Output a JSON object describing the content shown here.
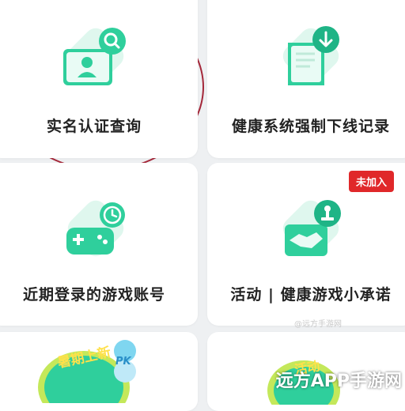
{
  "cards": {
    "realname": {
      "label": "实名认证查询"
    },
    "offline": {
      "label": "健康系统强制下线记录"
    },
    "login_accounts": {
      "label": "近期登录的游戏账号"
    },
    "activity": {
      "label": "活动 | 健康游戏小承诺",
      "badge": "未加入"
    }
  },
  "bottom_cards": {
    "left_banner_text": "暑期上新",
    "left_pk_text": "PK",
    "right_banner_text": "活动"
  },
  "watermark": "远方APP手游网",
  "faint_credit": "@远方手游网",
  "colors": {
    "accent_green": "#2fcf9c",
    "accent_green_dark": "#1fb486",
    "badge_red": "#e0282a",
    "annotation": "#a4283a"
  }
}
